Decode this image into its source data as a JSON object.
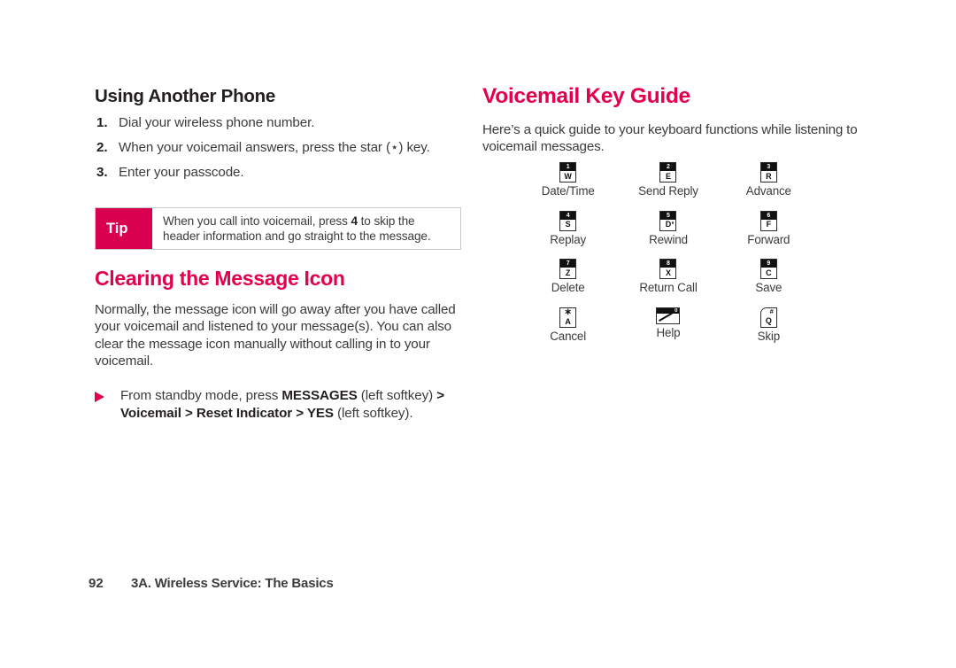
{
  "document": {
    "type": "user-manual-page",
    "page_number": "92",
    "footer_title": "3A. Wireless Service: The Basics",
    "accent_color": "#E3004F",
    "tip_block_color": "#D8004F",
    "body_text_color": "#3B3B3D"
  },
  "left_column": {
    "subheading": "Using Another Phone",
    "steps": [
      {
        "num": "1.",
        "text": "Dial your wireless phone number."
      },
      {
        "num": "2.",
        "text_before": "When your voicemail answers, press the star (⋆) key.",
        "text": "When your voicemail answers, press the star (⋆) key."
      },
      {
        "num": "3.",
        "text": "Enter your passcode."
      }
    ],
    "tip": {
      "label": "Tip",
      "text_part1": "When you call into voicemail, press ",
      "bold_key": "4",
      "text_part2": " to skip the header information and go straight to the message."
    },
    "section_heading": "Clearing the Message Icon",
    "paragraph": "Normally, the message icon will go away after you have called your voicemail and listened to your message(s). You can also clear the message icon manually without calling in to your voicemail.",
    "instruction": {
      "bullet_icon": "triangle-right-icon",
      "part1": "From standby mode, press ",
      "bold1": "MESSAGES",
      "part2": " (left softkey) ",
      "bold2": "> Voicemail > Reset Indicator > YES",
      "part3": " (left softkey)."
    }
  },
  "right_column": {
    "heading": "Voicemail Key Guide",
    "intro": "Here’s a quick guide to your keyboard functions while listening to voicemail messages.",
    "keys": [
      {
        "digit": "1",
        "letter": "W",
        "label": "Date/Time",
        "style": "dark"
      },
      {
        "digit": "2",
        "letter": "E",
        "label": "Send Reply",
        "style": "dark"
      },
      {
        "digit": "3",
        "letter": "R",
        "label": "Advance",
        "style": "dark"
      },
      {
        "digit": "4",
        "letter": "S",
        "label": "Replay",
        "style": "dark"
      },
      {
        "digit": "5",
        "letter": "D",
        "label": "Rewind",
        "style": "dark-dot"
      },
      {
        "digit": "6",
        "letter": "F",
        "label": "Forward",
        "style": "dark"
      },
      {
        "digit": "7",
        "letter": "Z",
        "label": "Delete",
        "style": "dark"
      },
      {
        "digit": "8",
        "letter": "X",
        "label": "Return Call",
        "style": "dark"
      },
      {
        "digit": "9",
        "letter": "C",
        "label": "Save",
        "style": "dark"
      },
      {
        "digit": "∗",
        "letter": "A",
        "label": "Cancel",
        "style": "plain"
      },
      {
        "digit": "0",
        "letter": "",
        "label": "Help",
        "style": "wide"
      },
      {
        "digit": "#",
        "letter": "Q",
        "label": "Skip",
        "style": "notch"
      }
    ]
  }
}
